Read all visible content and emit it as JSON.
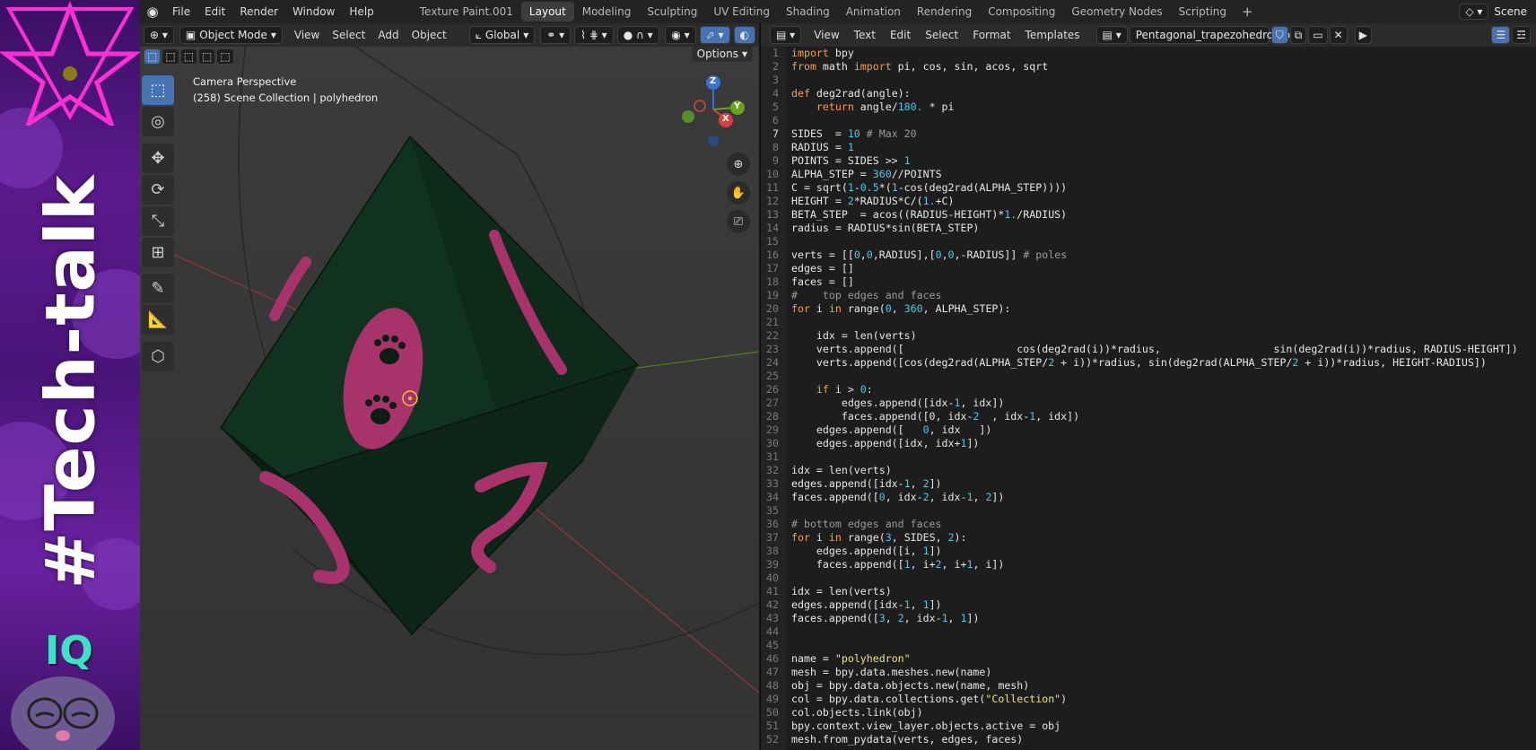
{
  "app": {
    "menus": [
      "File",
      "Edit",
      "Render",
      "Window",
      "Help"
    ],
    "workspace_tabs": [
      {
        "label": "Texture Paint.001",
        "active": false
      },
      {
        "label": "Layout",
        "active": true
      },
      {
        "label": "Modeling",
        "active": false
      },
      {
        "label": "Sculpting",
        "active": false
      },
      {
        "label": "UV Editing",
        "active": false
      },
      {
        "label": "Shading",
        "active": false
      },
      {
        "label": "Animation",
        "active": false
      },
      {
        "label": "Rendering",
        "active": false
      },
      {
        "label": "Compositing",
        "active": false
      },
      {
        "label": "Geometry Nodes",
        "active": false
      },
      {
        "label": "Scripting",
        "active": false
      }
    ],
    "add_tab": "+",
    "scene_label": "Scene"
  },
  "viewport": {
    "mode": "Object Mode",
    "menus": [
      "View",
      "Select",
      "Add",
      "Object"
    ],
    "transform_orientation": "Global",
    "options_label": "Options",
    "overlay_title": "Camera Perspective",
    "overlay_subtitle": "(258) Scene Collection | polyhedron",
    "gizmo_axes": [
      "Z",
      "Y",
      "X"
    ],
    "tools": [
      {
        "name": "select-box-tool",
        "glyph": "⬚",
        "active": true
      },
      {
        "name": "cursor-tool",
        "glyph": "◎",
        "active": false
      },
      {
        "name": "move-tool",
        "glyph": "✥",
        "active": false
      },
      {
        "name": "rotate-tool",
        "glyph": "⟳",
        "active": false
      },
      {
        "name": "scale-tool",
        "glyph": "⤡",
        "active": false
      },
      {
        "name": "transform-tool",
        "glyph": "⊞",
        "active": false
      },
      {
        "name": "annotate-tool",
        "glyph": "✎",
        "active": false
      },
      {
        "name": "measure-tool",
        "glyph": "📐",
        "active": false
      },
      {
        "name": "add-cube-tool",
        "glyph": "⬡",
        "active": false
      }
    ]
  },
  "sidebar_overlay": {
    "title": "#Tech-talk",
    "badge": "IQ"
  },
  "text_editor": {
    "menus": [
      "View",
      "Text",
      "Edit",
      "Select",
      "Format",
      "Templates"
    ],
    "filename": "Pentagonal_trapezohedron.py",
    "current_line": 7,
    "lines": [
      [
        [
          "kw",
          "import"
        ],
        [
          "pl",
          " bpy"
        ]
      ],
      [
        [
          "kw",
          "from"
        ],
        [
          "pl",
          " math "
        ],
        [
          "kw",
          "import"
        ],
        [
          "pl",
          " pi, cos, sin, acos, sqrt"
        ]
      ],
      [],
      [
        [
          "kw",
          "def"
        ],
        [
          "pl",
          " deg2rad(angle):"
        ]
      ],
      [
        [
          "pl",
          "    "
        ],
        [
          "kw",
          "return"
        ],
        [
          "pl",
          " angle/"
        ],
        [
          "num",
          "180."
        ],
        [
          "pl",
          " * pi"
        ]
      ],
      [],
      [
        [
          "pl",
          "SIDES  = "
        ],
        [
          "num",
          "10"
        ],
        [
          "cm",
          " # Max 20"
        ]
      ],
      [
        [
          "pl",
          "RADIUS = "
        ],
        [
          "num",
          "1"
        ]
      ],
      [
        [
          "pl",
          "POINTS = SIDES >> "
        ],
        [
          "num",
          "1"
        ]
      ],
      [
        [
          "pl",
          "ALPHA_STEP = "
        ],
        [
          "num",
          "360"
        ],
        [
          "pl",
          "//POINTS"
        ]
      ],
      [
        [
          "pl",
          "C = sqrt("
        ],
        [
          "num",
          "1"
        ],
        [
          "pl",
          "-"
        ],
        [
          "num",
          "0.5"
        ],
        [
          "pl",
          "*("
        ],
        [
          "num",
          "1"
        ],
        [
          "pl",
          "-cos(deg2rad(ALPHA_STEP))))"
        ]
      ],
      [
        [
          "pl",
          "HEIGHT = "
        ],
        [
          "num",
          "2"
        ],
        [
          "pl",
          "*RADIUS*C/("
        ],
        [
          "num",
          "1."
        ],
        [
          "pl",
          "+C)"
        ]
      ],
      [
        [
          "pl",
          "BETA_STEP  = acos((RADIUS-HEIGHT)*"
        ],
        [
          "num",
          "1."
        ],
        [
          "pl",
          "/RADIUS)"
        ]
      ],
      [
        [
          "pl",
          "radius = RADIUS*sin(BETA_STEP)"
        ]
      ],
      [],
      [
        [
          "pl",
          "verts = [["
        ],
        [
          "num",
          "0"
        ],
        [
          "pl",
          ","
        ],
        [
          "num",
          "0"
        ],
        [
          "pl",
          ",RADIUS],["
        ],
        [
          "num",
          "0"
        ],
        [
          "pl",
          ","
        ],
        [
          "num",
          "0"
        ],
        [
          "pl",
          ",-RADIUS]]"
        ],
        [
          "cm",
          " # poles"
        ]
      ],
      [
        [
          "pl",
          "edges = []"
        ]
      ],
      [
        [
          "pl",
          "faces = []"
        ]
      ],
      [
        [
          "cm",
          "#    top edges and faces"
        ]
      ],
      [
        [
          "kw",
          "for"
        ],
        [
          "pl",
          " i "
        ],
        [
          "kw",
          "in"
        ],
        [
          "pl",
          " range("
        ],
        [
          "num",
          "0"
        ],
        [
          "pl",
          ", "
        ],
        [
          "num",
          "360"
        ],
        [
          "pl",
          ", ALPHA_STEP):"
        ]
      ],
      [],
      [
        [
          "pl",
          "    idx = len(verts)"
        ]
      ],
      [
        [
          "pl",
          "    verts.append([                  cos(deg2rad(i))*radius,                  sin(deg2rad(i))*radius, RADIUS-HEIGHT])"
        ]
      ],
      [
        [
          "pl",
          "    verts.append([cos(deg2rad(ALPHA_STEP/"
        ],
        [
          "num",
          "2"
        ],
        [
          "pl",
          " + i))*radius, sin(deg2rad(ALPHA_STEP/"
        ],
        [
          "num",
          "2"
        ],
        [
          "pl",
          " + i))*radius, HEIGHT-RADIUS])"
        ]
      ],
      [],
      [
        [
          "pl",
          "    "
        ],
        [
          "kw",
          "if"
        ],
        [
          "pl",
          " i > "
        ],
        [
          "num",
          "0"
        ],
        [
          "pl",
          ":"
        ]
      ],
      [
        [
          "pl",
          "        edges.append([idx-"
        ],
        [
          "num",
          "1"
        ],
        [
          "pl",
          ", idx])"
        ]
      ],
      [
        [
          "pl",
          "        faces.append([0, idx-"
        ],
        [
          "num",
          "2"
        ],
        [
          "pl",
          "  , idx-"
        ],
        [
          "num",
          "1"
        ],
        [
          "pl",
          ", idx])"
        ]
      ],
      [
        [
          "pl",
          "    edges.append([   "
        ],
        [
          "num",
          "0"
        ],
        [
          "pl",
          ", idx   ])"
        ]
      ],
      [
        [
          "pl",
          "    edges.append([idx, idx+"
        ],
        [
          "num",
          "1"
        ],
        [
          "pl",
          "])"
        ]
      ],
      [],
      [
        [
          "pl",
          "idx = len(verts)"
        ]
      ],
      [
        [
          "pl",
          "edges.append([idx-"
        ],
        [
          "num",
          "1"
        ],
        [
          "pl",
          ", "
        ],
        [
          "num",
          "2"
        ],
        [
          "pl",
          "])"
        ]
      ],
      [
        [
          "pl",
          "faces.append(["
        ],
        [
          "num",
          "0"
        ],
        [
          "pl",
          ", idx-"
        ],
        [
          "num",
          "2"
        ],
        [
          "pl",
          ", idx-"
        ],
        [
          "num",
          "1"
        ],
        [
          "pl",
          ", "
        ],
        [
          "num",
          "2"
        ],
        [
          "pl",
          "])"
        ]
      ],
      [],
      [
        [
          "cm",
          "# bottom edges and faces"
        ]
      ],
      [
        [
          "kw",
          "for"
        ],
        [
          "pl",
          " i "
        ],
        [
          "kw",
          "in"
        ],
        [
          "pl",
          " range("
        ],
        [
          "num",
          "3"
        ],
        [
          "pl",
          ", SIDES, "
        ],
        [
          "num",
          "2"
        ],
        [
          "pl",
          "):"
        ]
      ],
      [
        [
          "pl",
          "    edges.append([i, "
        ],
        [
          "num",
          "1"
        ],
        [
          "pl",
          "])"
        ]
      ],
      [
        [
          "pl",
          "    faces.append(["
        ],
        [
          "num",
          "1"
        ],
        [
          "pl",
          ", i+"
        ],
        [
          "num",
          "2"
        ],
        [
          "pl",
          ", i+"
        ],
        [
          "num",
          "1"
        ],
        [
          "pl",
          ", i])"
        ]
      ],
      [],
      [
        [
          "pl",
          "idx = len(verts)"
        ]
      ],
      [
        [
          "pl",
          "edges.append([idx-"
        ],
        [
          "num",
          "1"
        ],
        [
          "pl",
          ", "
        ],
        [
          "num",
          "1"
        ],
        [
          "pl",
          "])"
        ]
      ],
      [
        [
          "pl",
          "faces.append(["
        ],
        [
          "num",
          "3"
        ],
        [
          "pl",
          ", "
        ],
        [
          "num",
          "2"
        ],
        [
          "pl",
          ", idx-"
        ],
        [
          "num",
          "1"
        ],
        [
          "pl",
          ", "
        ],
        [
          "num",
          "1"
        ],
        [
          "pl",
          "])"
        ]
      ],
      [],
      [],
      [
        [
          "pl",
          "name = "
        ],
        [
          "str",
          "\"polyhedron\""
        ]
      ],
      [
        [
          "pl",
          "mesh = bpy.data.meshes.new(name)"
        ]
      ],
      [
        [
          "pl",
          "obj = bpy.data.objects.new(name, mesh)"
        ]
      ],
      [
        [
          "pl",
          "col = bpy.data.collections.get("
        ],
        [
          "str",
          "\"Collection\""
        ],
        [
          "pl",
          ")"
        ]
      ],
      [
        [
          "pl",
          "col.objects.link(obj)"
        ]
      ],
      [
        [
          "pl",
          "bpy.context.view_layer.objects.active = obj"
        ]
      ],
      [
        [
          "pl",
          "mesh.from_pydata(verts, edges, faces)"
        ]
      ]
    ]
  },
  "colors": {
    "accent": "#4772b3",
    "die_face": "#0f2a17",
    "paw": "#a8336a"
  }
}
